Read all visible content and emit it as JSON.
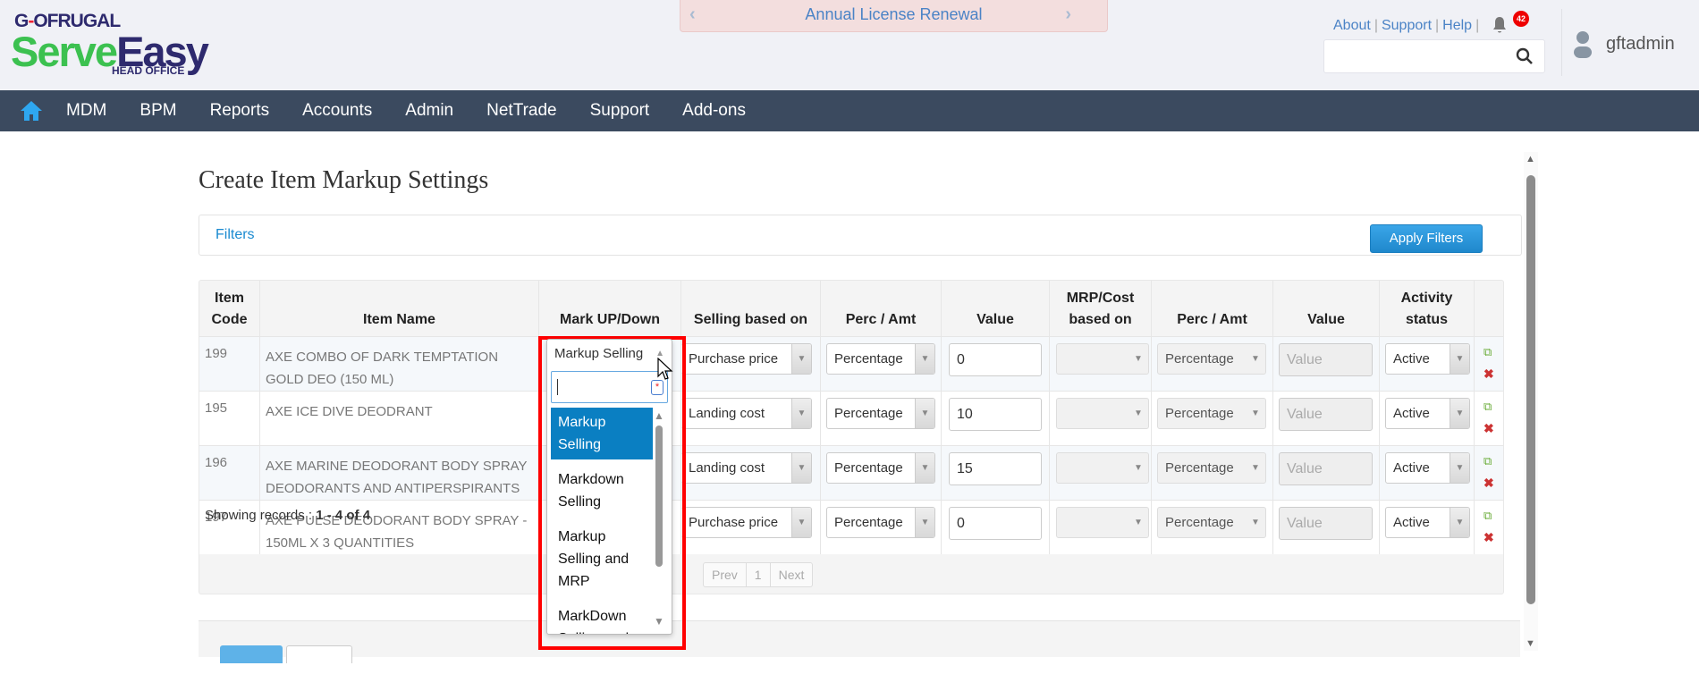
{
  "brand": {
    "top": "GOFRUGAL",
    "main_green": "Serve",
    "main_purple": "Easy",
    "sub": "HEAD OFFICE"
  },
  "banner": {
    "text": "Annual License Renewal"
  },
  "toplinks": {
    "about": "About",
    "support": "Support",
    "help": "Help",
    "notifications": "42"
  },
  "search": {
    "placeholder": "",
    "value": ""
  },
  "user": {
    "name": "gftadmin"
  },
  "nav": {
    "items": [
      "MDM",
      "BPM",
      "Reports",
      "Accounts",
      "Admin",
      "NetTrade",
      "Support",
      "Add-ons"
    ]
  },
  "page": {
    "title": "Create Item Markup Settings"
  },
  "filters": {
    "label": "Filters",
    "apply": "Apply Filters"
  },
  "table": {
    "headers": [
      "Item Code",
      "Item Name",
      "Mark UP/Down",
      "Selling based on",
      "Perc / Amt",
      "Value",
      "MRP/Cost based on",
      "Perc / Amt",
      "Value",
      "Activity status"
    ],
    "rows": [
      {
        "code": "199",
        "name": "AXE COMBO OF DARK TEMPTATION GOLD DEO (150 ML)",
        "markup": "Markup Selling",
        "selling": "Purchase price",
        "perc": "Percentage",
        "value": "0",
        "mrp": "",
        "perc2": "Percentage",
        "value2_placeholder": "Value",
        "status": "Active"
      },
      {
        "code": "195",
        "name": "AXE ICE DIVE DEODRANT",
        "markup": "",
        "selling": "Landing cost",
        "perc": "Percentage",
        "value": "10",
        "mrp": "",
        "perc2": "Percentage",
        "value2_placeholder": "Value",
        "status": "Active"
      },
      {
        "code": "196",
        "name": "AXE MARINE DEODORANT BODY SPRAY DEODORANTS AND ANTIPERSPIRANTS",
        "markup": "",
        "selling": "Landing cost",
        "perc": "Percentage",
        "value": "15",
        "mrp": "",
        "perc2": "Percentage",
        "value2_placeholder": "Value",
        "status": "Active"
      },
      {
        "code": "197",
        "name": "AXE PULSE DEODORANT BODY SPRAY - 150ML X 3 QUANTITIES",
        "markup": "",
        "selling": "Purchase price",
        "perc": "Percentage",
        "value": "0",
        "mrp": "",
        "perc2": "Percentage",
        "value2_placeholder": "Value",
        "status": "Active"
      }
    ],
    "showing_label": "Showing records : ",
    "showing_range": "1 - 4 of 4",
    "pager": {
      "prev": "Prev",
      "page": "1",
      "next": "Next"
    }
  },
  "dropdown": {
    "selected": "Markup Selling",
    "search": "",
    "options": [
      "Markup Selling",
      "Markdown Selling",
      "Markup Selling and MRP",
      "MarkDown Selling and"
    ],
    "highlighted_index": 0
  },
  "colors": {
    "nav": "#3b4a5f",
    "accent": "#0a7fc2",
    "highlight_box": "#ff0000"
  }
}
